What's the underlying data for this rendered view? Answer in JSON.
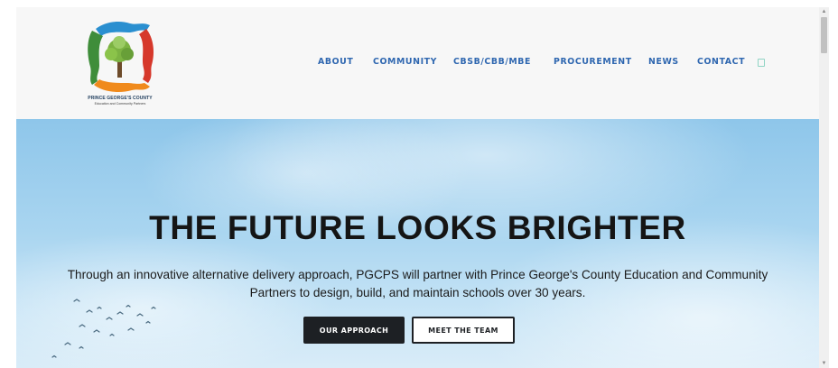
{
  "logo": {
    "line1": "PRINCE GEORGE'S COUNTY",
    "line2": "Education and Community Partners",
    "icon": "hands-tree-logo"
  },
  "nav": {
    "items": [
      {
        "label": "ABOUT"
      },
      {
        "label": "COMMUNITY"
      },
      {
        "label": "CBSB/CBB/MBE"
      },
      {
        "label": "PROCUREMENT"
      },
      {
        "label": "NEWS"
      },
      {
        "label": "CONTACT"
      }
    ],
    "search_icon": "search-icon"
  },
  "hero": {
    "title": "THE FUTURE LOOKS BRIGHTER",
    "subtitle": "Through an innovative alternative delivery approach, PGCPS will partner with Prince George's County Education and Community Partners to design, build, and maintain schools over 30 years.",
    "primary_button": "OUR APPROACH",
    "secondary_button": "MEET THE TEAM"
  },
  "colors": {
    "nav_link": "#2f67b0",
    "button_dark": "#1d2024",
    "sky": "#a9d5f0"
  }
}
